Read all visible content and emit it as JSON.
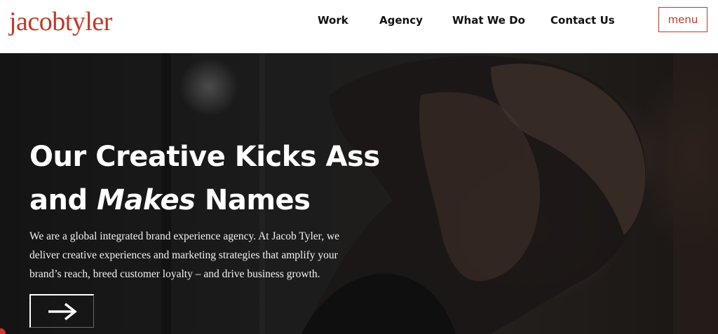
{
  "brand": {
    "logo_text": "jacobtyler",
    "accent_color": "#c0392b"
  },
  "nav": {
    "items": [
      {
        "label": "Work"
      },
      {
        "label": "Agency"
      },
      {
        "label": "What We Do"
      },
      {
        "label": "Contact Us"
      }
    ],
    "menu_label": "menu"
  },
  "hero": {
    "title_line1": "Our Creative Kicks Ass",
    "title_line2_prefix": "and ",
    "title_line2_em": "Makes",
    "title_line2_suffix": " Names",
    "description": "We are a global integrated brand experience agency. At Jacob Tyler, we deliver creative experiences and marketing strategies that amplify your brand’s reach, breed customer loyalty – and drive business growth.",
    "cta_icon": "arrow-right-icon"
  }
}
